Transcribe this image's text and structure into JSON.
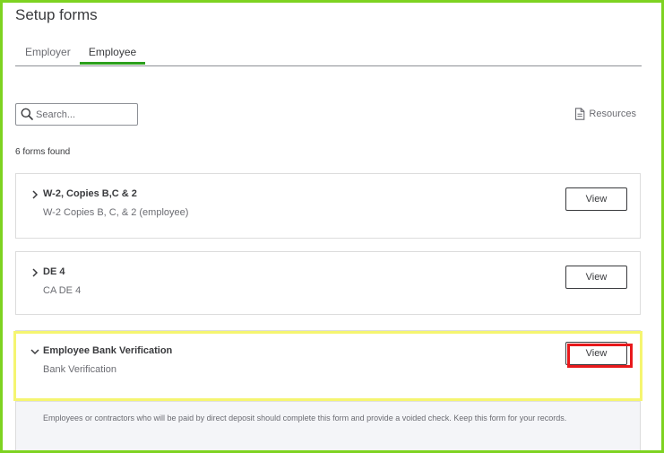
{
  "page": {
    "title": "Setup forms"
  },
  "tabs": [
    {
      "label": "Employer",
      "active": false
    },
    {
      "label": "Employee",
      "active": true
    }
  ],
  "search": {
    "placeholder": "Search...",
    "value": "",
    "icon": "search-icon"
  },
  "resources": {
    "label": "Resources",
    "icon": "document-icon"
  },
  "results": {
    "count_text": "6 forms found"
  },
  "forms": [
    {
      "title": "W-2, Copies B,C & 2",
      "subtitle": "W-2 Copies B, C, & 2 (employee)",
      "view_label": "View",
      "expanded": false
    },
    {
      "title": "DE 4",
      "subtitle": "CA DE 4",
      "view_label": "View",
      "expanded": false
    },
    {
      "title": "Employee Bank Verification",
      "subtitle": "Bank Verification",
      "view_label": "View",
      "expanded": true,
      "description": "Employees or contractors who will be paid by direct deposit should complete this form and provide a voided check. Keep this form for your records."
    }
  ],
  "colors": {
    "accent_green": "#2ca01c",
    "frame_border": "#7ed321",
    "highlight_yellow": "#f5f570",
    "highlight_red": "#e8191c",
    "text_primary": "#393a3d",
    "text_secondary": "#6b6c72"
  }
}
